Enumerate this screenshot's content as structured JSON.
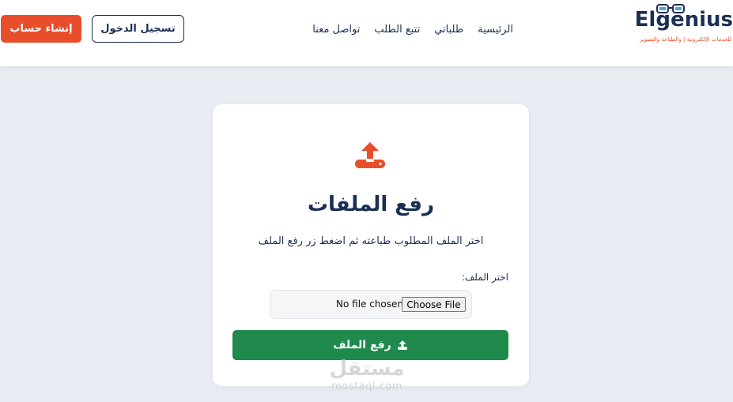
{
  "brand": {
    "logo_el": "El",
    "logo_genius": "genius",
    "logo_tagline": "للخدمات الإلكترونية | والطباعة والتصوير",
    "accent_color": "#e94e2c",
    "primary_color": "#1b2f55"
  },
  "nav": {
    "items": [
      {
        "label": "الرئيسية"
      },
      {
        "label": "طلباتي"
      },
      {
        "label": "تتبع الطلب"
      },
      {
        "label": "تواصل معنا"
      }
    ]
  },
  "auth": {
    "login_label": "تسجيل الدخول",
    "register_label": "إنشاء حساب"
  },
  "upload": {
    "icon": "upload-icon",
    "title": "رفع الملفات",
    "description": "اختر الملف المطلوب طباعته ثم اضغط زر رفع الملف",
    "file_label": "اختر الملف:",
    "choose_button": "Choose File",
    "file_status": "No file chosen",
    "submit_label": "رفع الملف",
    "submit_color": "#1f8a4c"
  },
  "watermark": {
    "arabic": "مستقل",
    "latin": "mostaql.com"
  }
}
